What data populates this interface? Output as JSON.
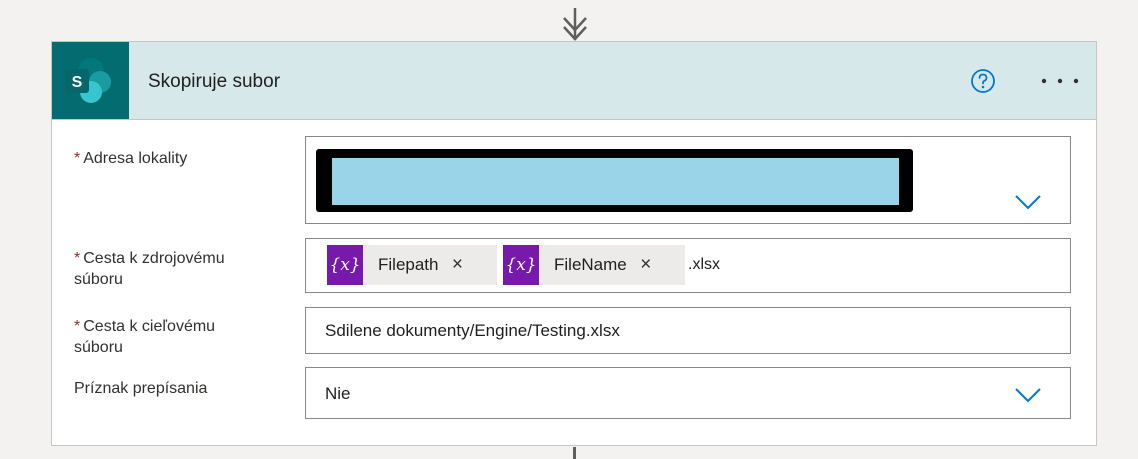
{
  "card": {
    "title": "Skopiruje subor",
    "connector_icon": "sharepoint-icon",
    "connector_letter": "S",
    "header_color": "#d7e8ea",
    "brand_color": "#036c70"
  },
  "fields": {
    "site_address": {
      "required_mark": "*",
      "label": "Adresa lokality",
      "redacted": true
    },
    "source_path": {
      "required_mark": "*",
      "label_line1": "Cesta k zdrojovému",
      "label_line2": "súboru",
      "tokens": [
        {
          "icon": "{x}",
          "label": "Filepath",
          "remove": "×"
        },
        {
          "icon": "{x}",
          "label": "FileName",
          "remove": "×"
        }
      ],
      "suffix": ".xlsx"
    },
    "dest_path": {
      "required_mark": "*",
      "label_line1": "Cesta k cieľovému",
      "label_line2": "súboru",
      "value": "Sdilene dokumenty/Engine/Testing.xlsx"
    },
    "overwrite": {
      "label": "Príznak prepísania",
      "value": "Nie"
    }
  },
  "colors": {
    "accent": "#0078d4",
    "required": "#a4262c",
    "token_bg": "#7719aa"
  },
  "icons": [
    "down-arrow-connector-icon",
    "sharepoint-icon",
    "help-icon",
    "more-icon",
    "chevron-down-icon"
  ]
}
